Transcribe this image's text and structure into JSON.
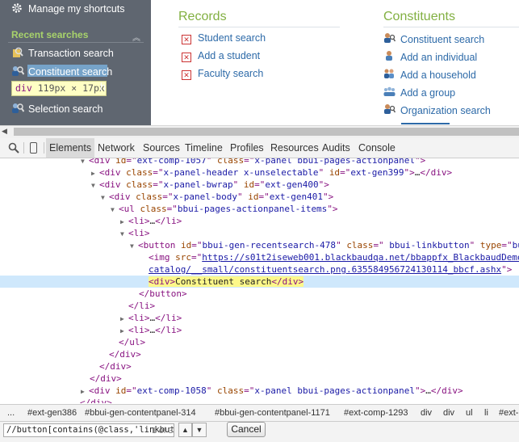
{
  "app": {
    "sidebar": {
      "top_item": "Manage my shortcuts",
      "recent_header": "Recent searches",
      "recent_items": [
        "Transaction search",
        "Constituent search",
        "Selection search"
      ],
      "tooltip": {
        "tag": "div",
        "size": "119px × 17px"
      },
      "tooltip_overflow": "h"
    },
    "columns": {
      "records": {
        "title": "Records",
        "links": [
          "Student search",
          "Add a student",
          "Faculty search"
        ]
      },
      "constituents": {
        "title": "Constituents",
        "links": [
          "Constituent search",
          "Add an individual",
          "Add a household",
          "Add a group",
          "Organization search"
        ]
      }
    }
  },
  "devtools": {
    "tabs": [
      "Elements",
      "Network",
      "Sources",
      "Timeline",
      "Profiles",
      "Resources",
      "Audits",
      "Console"
    ],
    "dom_lines": {
      "l1": {
        "tag": "div",
        "id": "ext-comp-1057",
        "class": "x-panel bbui-pages-actionpanel"
      },
      "l2": {
        "id": "ext-gen399",
        "class": "x-panel-header x-unselectable"
      },
      "l3": {
        "id": "ext-gen400",
        "class": "x-panel-bwrap"
      },
      "l4": {
        "id": "ext-gen401",
        "class": "x-panel-body"
      },
      "l5": {
        "class": "bbui-pages-actionpanel-items"
      },
      "l8": {
        "id": "bbui-gen-recentsearch-478",
        "class": " bbui-linkbutton",
        "type_attr": "bu"
      },
      "l9": {
        "src": "https://s01t2iseweb001.blackbaudqa.net/bbappfx_BlackbaudDemo"
      },
      "l10": {
        "src_cont": "catalog/__small/constituentsearch.png.635584956724130114_bbcf.ashx"
      },
      "l11": {
        "text": "Constituent search"
      },
      "l21": {
        "id": "ext-comp-1058",
        "class": "x-panel bbui-pages-actionpanel"
      }
    },
    "breadcrumbs": [
      "...",
      "#ext-gen386",
      "#bbui-gen-contentpanel-314",
      "#bbui-gen-contentpanel-1171",
      "#ext-comp-1293",
      "div",
      "div",
      "ul",
      "li",
      "#ext-"
    ],
    "find": {
      "query": "//button[contains(@class,'linkbut",
      "count": "1 of 3",
      "cancel_label": "Cancel"
    }
  }
}
